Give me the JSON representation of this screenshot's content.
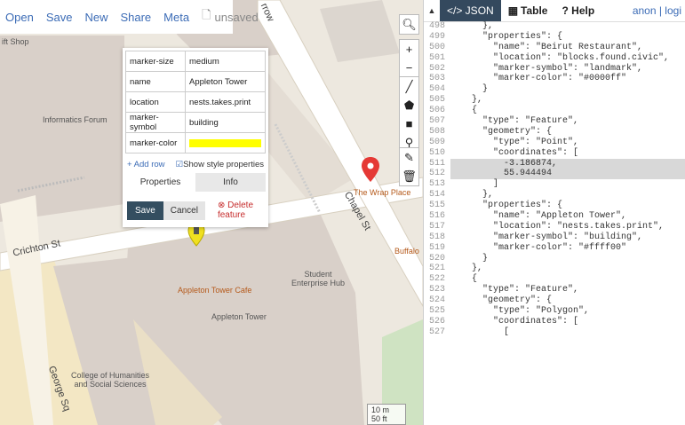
{
  "menu": {
    "items": [
      "Open",
      "Save",
      "New",
      "Share",
      "Meta"
    ],
    "status": "unsaved"
  },
  "map": {
    "labels": {
      "gift_shop": "ift Shop",
      "informatics": "Informatics Forum",
      "crichton": "Crichton St",
      "chapel": "Chapel St",
      "wrap": "The Wrap Place",
      "buffalo": "Buffalo",
      "student": "Student\nEnterprise Hub",
      "cafe": "Appleton Tower Cafe",
      "tower": "Appleton Tower",
      "college": "College of Humanities\nand Social Sciences",
      "george": "George Sq",
      "arrow_road": "rrow"
    },
    "scale": [
      "10 m",
      "50 ft"
    ]
  },
  "popup": {
    "rows": [
      {
        "key": "marker-size",
        "value": "medium"
      },
      {
        "key": "name",
        "value": "Appleton Tower"
      },
      {
        "key": "location",
        "value": "nests.takes.print"
      },
      {
        "key": "marker-symbol",
        "value": "building"
      },
      {
        "key": "marker-color",
        "value": "",
        "swatch": "#ffff00"
      }
    ],
    "add_row": "+ Add row",
    "show_style": "Show style properties",
    "tab_properties": "Properties",
    "tab_info": "Info",
    "save": "Save",
    "cancel": "Cancel",
    "delete": "Delete feature"
  },
  "panel": {
    "tabs": [
      "</> JSON",
      "Table",
      "? Help"
    ],
    "user": "anon | logi"
  },
  "code_lines": [
    {
      "n": "498",
      "t": "      },"
    },
    {
      "n": "499",
      "t": "      \"properties\": {"
    },
    {
      "n": "500",
      "t": "        \"name\": \"Beirut Restaurant\","
    },
    {
      "n": "501",
      "t": "        \"location\": \"blocks.found.civic\","
    },
    {
      "n": "502",
      "t": "        \"marker-symbol\": \"landmark\","
    },
    {
      "n": "503",
      "t": "        \"marker-color\": \"#0000ff\""
    },
    {
      "n": "504",
      "t": "      }"
    },
    {
      "n": "505",
      "t": "    },"
    },
    {
      "n": "506",
      "t": "    {"
    },
    {
      "n": "507",
      "t": "      \"type\": \"Feature\","
    },
    {
      "n": "508",
      "t": "      \"geometry\": {"
    },
    {
      "n": "509",
      "t": "        \"type\": \"Point\","
    },
    {
      "n": "510",
      "t": "        \"coordinates\": ["
    },
    {
      "n": "511",
      "t": "          -3.186874,",
      "hl": true
    },
    {
      "n": "512",
      "t": "          55.944494",
      "hl": true
    },
    {
      "n": "513",
      "t": "        ]"
    },
    {
      "n": "514",
      "t": "      },"
    },
    {
      "n": "515",
      "t": "      \"properties\": {"
    },
    {
      "n": "516",
      "t": "        \"name\": \"Appleton Tower\","
    },
    {
      "n": "517",
      "t": "        \"location\": \"nests.takes.print\","
    },
    {
      "n": "518",
      "t": "        \"marker-symbol\": \"building\","
    },
    {
      "n": "519",
      "t": "        \"marker-color\": \"#ffff00\""
    },
    {
      "n": "520",
      "t": "      }"
    },
    {
      "n": "521",
      "t": "    },"
    },
    {
      "n": "522",
      "t": "    {"
    },
    {
      "n": "523",
      "t": "      \"type\": \"Feature\","
    },
    {
      "n": "524",
      "t": "      \"geometry\": {"
    },
    {
      "n": "525",
      "t": "        \"type\": \"Polygon\","
    },
    {
      "n": "526",
      "t": "        \"coordinates\": ["
    },
    {
      "n": "527",
      "t": "          ["
    }
  ],
  "colors": {
    "accent": "#3c6cb6",
    "tab_active": "#34495e",
    "marker_red": "#e53935",
    "marker_yellow": "#ffff00"
  }
}
